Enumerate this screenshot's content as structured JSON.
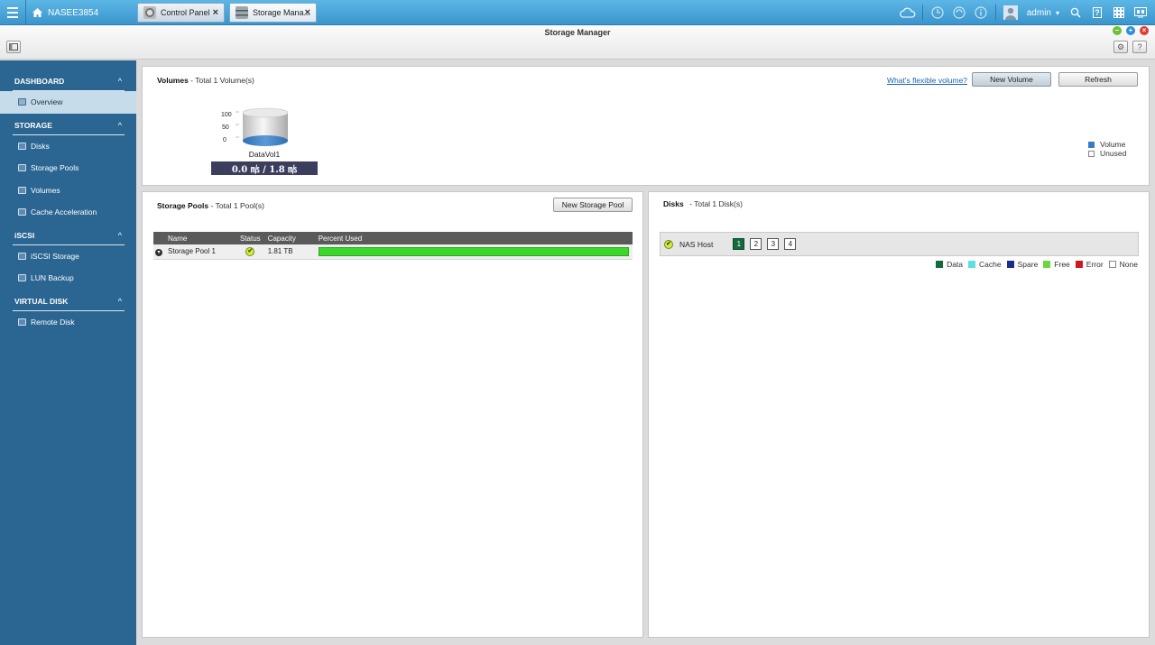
{
  "topbar": {
    "nas_name": "NASEE3854",
    "tabs": [
      {
        "label": "Control Panel",
        "active": false
      },
      {
        "label": "Storage Mana...",
        "active": true
      }
    ],
    "user": "admin"
  },
  "window": {
    "title": "Storage Manager"
  },
  "sidebar": {
    "sections": [
      {
        "title": "DASHBOARD",
        "items": [
          "Overview"
        ]
      },
      {
        "title": "STORAGE",
        "items": [
          "Disks",
          "Storage Pools",
          "Volumes",
          "Cache Acceleration"
        ]
      },
      {
        "title": "iSCSI",
        "items": [
          "iSCSI Storage",
          "LUN Backup"
        ]
      },
      {
        "title": "VIRTUAL DISK",
        "items": [
          "Remote Disk"
        ]
      }
    ],
    "selected": "Overview"
  },
  "volumes": {
    "title": "Volumes",
    "subtitle": "- Total 1 Volume(s)",
    "help_link": "What's flexible volume?",
    "new_button": "New Volume",
    "refresh_button": "Refresh",
    "axis_ticks": [
      "100",
      "50",
      "0"
    ],
    "volume_name": "DataVol1",
    "usage_text": "0.0 ㎧ / 1.8 ㎧",
    "percent_used": 0.0,
    "legend": [
      "Volume",
      "Unused"
    ],
    "colors": {
      "volume": "#3a7cc4",
      "unused": "#ffffff"
    }
  },
  "pools": {
    "title": "Storage Pools",
    "subtitle": "- Total 1 Pool(s)",
    "new_button": "New Storage Pool",
    "columns": [
      "Name",
      "Status",
      "Capacity",
      "Percent Used"
    ],
    "rows": [
      {
        "name": "Storage Pool 1",
        "status": "ok",
        "capacity": "1.81 TB",
        "percent_free_fill": 1.0
      }
    ],
    "bar_color": "#3dd62b"
  },
  "disks": {
    "title": "Disks",
    "subtitle": "- Total 1 Disk(s)",
    "host_label": "NAS Host",
    "slots": [
      "1",
      "2",
      "3",
      "4"
    ],
    "active_slot": "1",
    "legend": [
      {
        "label": "Data",
        "color": "#136a3c"
      },
      {
        "label": "Cache",
        "color": "#5ce0e0"
      },
      {
        "label": "Spare",
        "color": "#1a2f8a"
      },
      {
        "label": "Free",
        "color": "#6bd63f"
      },
      {
        "label": "Error",
        "color": "#d01a1a"
      },
      {
        "label": "None",
        "color": "#ffffff"
      }
    ]
  }
}
